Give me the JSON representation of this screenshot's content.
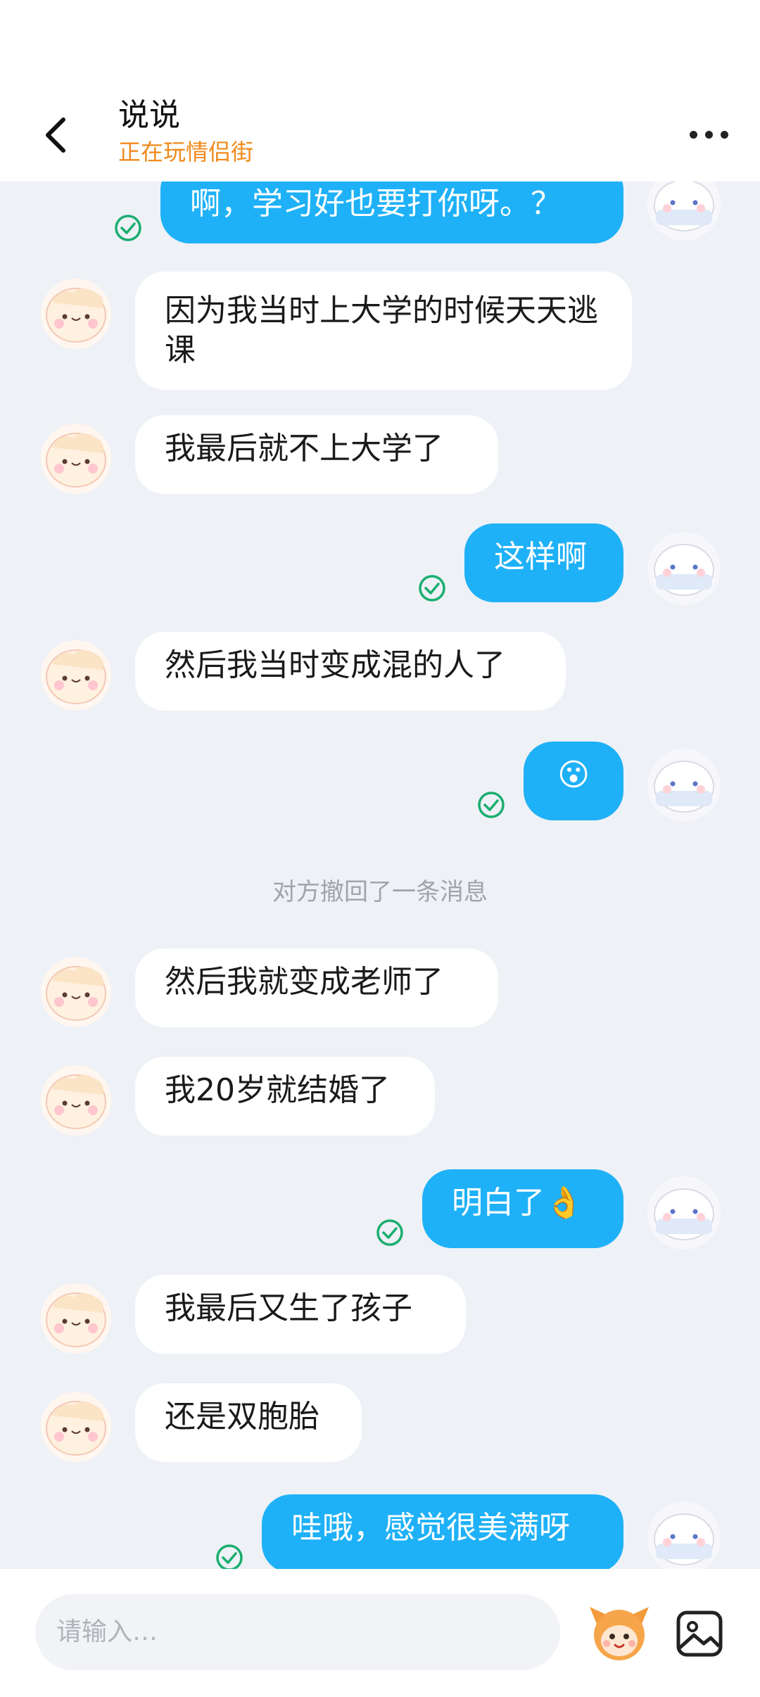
{
  "header": {
    "title": "说说",
    "subtitle": "正在玩情侣街"
  },
  "messages": [
    {
      "side": "out",
      "text": "啊，学习好也要打你呀。？"
    },
    {
      "side": "in",
      "text": "因为我当时上大学的时候天天逃课"
    },
    {
      "side": "in",
      "text": "我最后就不上大学了"
    },
    {
      "side": "out",
      "text": "这样啊"
    },
    {
      "side": "in",
      "text": "然后我当时变成混的人了"
    },
    {
      "side": "out",
      "text": "😮"
    },
    {
      "side": "system",
      "text": "对方撤回了一条消息"
    },
    {
      "side": "in",
      "text": "然后我就变成老师了"
    },
    {
      "side": "in",
      "text": "我20岁就结婚了"
    },
    {
      "side": "out",
      "text": "明白了👌"
    },
    {
      "side": "in",
      "text": "我最后又生了孩子"
    },
    {
      "side": "in",
      "text": "还是双胞胎"
    },
    {
      "side": "out",
      "text": "哇哦，感觉很美满呀"
    }
  ],
  "input": {
    "placeholder": "请输入…"
  },
  "colors": {
    "outgoing_bubble": "#1fb1f7",
    "incoming_bubble": "#ffffff",
    "read_check": "#1aae6f",
    "subtitle": "#f08a1c",
    "background": "#eef1f6"
  },
  "icons": {
    "back": "back-chevron-icon",
    "more": "more-dots-icon",
    "read": "read-check-icon",
    "mascot": "mascot-icon",
    "image": "image-icon"
  }
}
